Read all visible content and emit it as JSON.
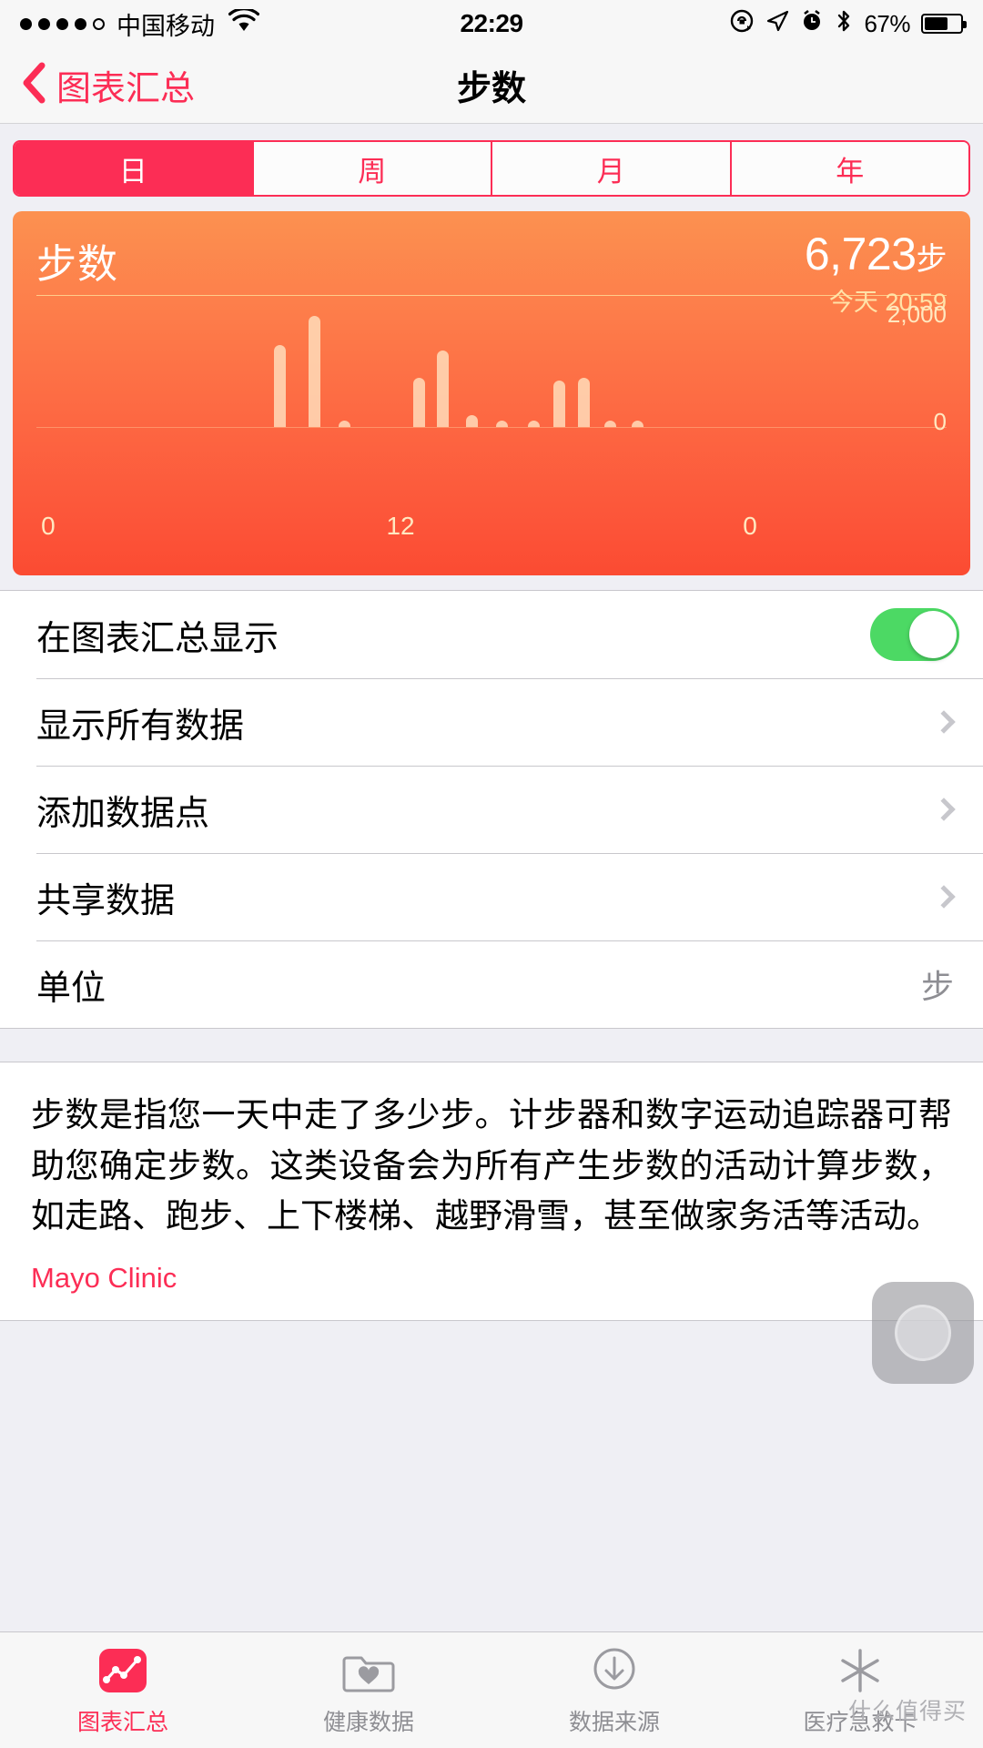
{
  "status_bar": {
    "signal_dots_filled": 4,
    "signal_dots_total": 5,
    "carrier": "中国移动",
    "wifi_icon": "wifi-icon",
    "time": "22:29",
    "rotation_lock_icon": "rotation-lock-icon",
    "location_icon": "location-arrow-icon",
    "alarm_icon": "alarm-clock-icon",
    "bluetooth_icon": "bluetooth-icon",
    "battery_percent": "67%",
    "battery_level": 67
  },
  "nav": {
    "back_label": "图表汇总",
    "back_icon": "chevron-left-icon",
    "title": "步数"
  },
  "segmented": {
    "options": [
      "日",
      "周",
      "月",
      "年"
    ],
    "selected_index": 0,
    "accent": "#fc2d55"
  },
  "chart_card": {
    "name": "步数",
    "value": "6,723",
    "unit": "步",
    "timestamp": "今天 20:59",
    "gradient_from": "#fc9150",
    "gradient_to": "#fb4b32"
  },
  "chart_data": {
    "type": "bar",
    "title": "步数",
    "xlabel": "",
    "ylabel": "",
    "ylim": [
      0,
      2000
    ],
    "grid": true,
    "y_ticks": [
      "2,000",
      "0"
    ],
    "x_ticks": [
      "0",
      "12",
      "0"
    ],
    "x_tick_positions_pct": [
      3.7,
      40.5,
      77.0
    ],
    "x": [
      0,
      1,
      2,
      3,
      4,
      5,
      6,
      7,
      8,
      9,
      10,
      11,
      12,
      13,
      14,
      15,
      16,
      17,
      18,
      19,
      20,
      21,
      22,
      23
    ],
    "bars": [
      {
        "x_pct": 26.1,
        "value": 1320
      },
      {
        "x_pct": 29.9,
        "value": 1780
      },
      {
        "x_pct": 33.2,
        "value": 30
      },
      {
        "x_pct": 41.4,
        "value": 790
      },
      {
        "x_pct": 44.0,
        "value": 1230
      },
      {
        "x_pct": 47.2,
        "value": 190
      },
      {
        "x_pct": 50.5,
        "value": 45
      },
      {
        "x_pct": 54.0,
        "value": 45
      },
      {
        "x_pct": 56.8,
        "value": 740
      },
      {
        "x_pct": 59.5,
        "value": 790
      },
      {
        "x_pct": 62.4,
        "value": 40
      },
      {
        "x_pct": 65.4,
        "value": 40
      }
    ]
  },
  "settings": {
    "rows": [
      {
        "label": "在图表汇总显示",
        "control": "toggle",
        "value": "on"
      },
      {
        "label": "显示所有数据",
        "control": "chevron",
        "value": ""
      },
      {
        "label": "添加数据点",
        "control": "chevron",
        "value": ""
      },
      {
        "label": "共享数据",
        "control": "chevron",
        "value": ""
      },
      {
        "label": "单位",
        "control": "value",
        "value": "步"
      }
    ]
  },
  "description": {
    "text": "步数是指您一天中走了多少步。计步器和数字运动追踪器可帮助您确定步数。这类设备会为所有产生步数的活动计算步数，如走路、跑步、上下楼梯、越野滑雪，甚至做家务活等活动。",
    "source": "Mayo Clinic"
  },
  "tab_bar": {
    "tabs": [
      {
        "label": "图表汇总",
        "icon": "chart-summary-icon",
        "active": true
      },
      {
        "label": "健康数据",
        "icon": "health-data-folder-icon",
        "active": false
      },
      {
        "label": "数据来源",
        "icon": "data-sources-download-icon",
        "active": false
      },
      {
        "label": "医疗急救卡",
        "icon": "medical-id-asterisk-icon",
        "active": false
      }
    ]
  },
  "overlay": {
    "assistive_touch_icon": "assistive-touch-icon",
    "watermark": "什么值得买"
  }
}
